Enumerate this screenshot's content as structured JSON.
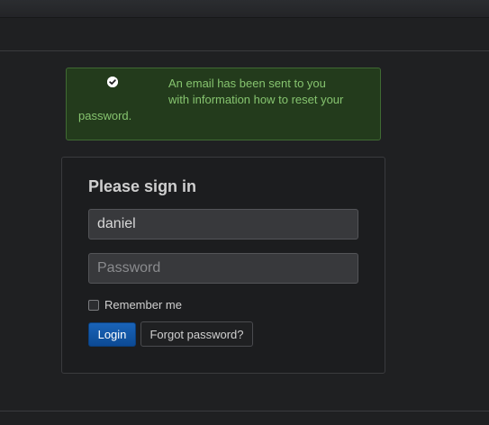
{
  "alert": {
    "icon": "check-circle-icon",
    "line1": "An email has been sent to you",
    "line2": "with information how to reset your",
    "line3": "password."
  },
  "login": {
    "heading": "Please sign in",
    "username_value": "daniel",
    "password_placeholder": "Password",
    "remember_label": "Remember me",
    "login_button": "Login",
    "forgot_button": "Forgot password?"
  },
  "colors": {
    "background": "#1f2022",
    "alert_bg": "#233b1c",
    "alert_text": "#86c46f",
    "primary": "#1a64b8"
  }
}
